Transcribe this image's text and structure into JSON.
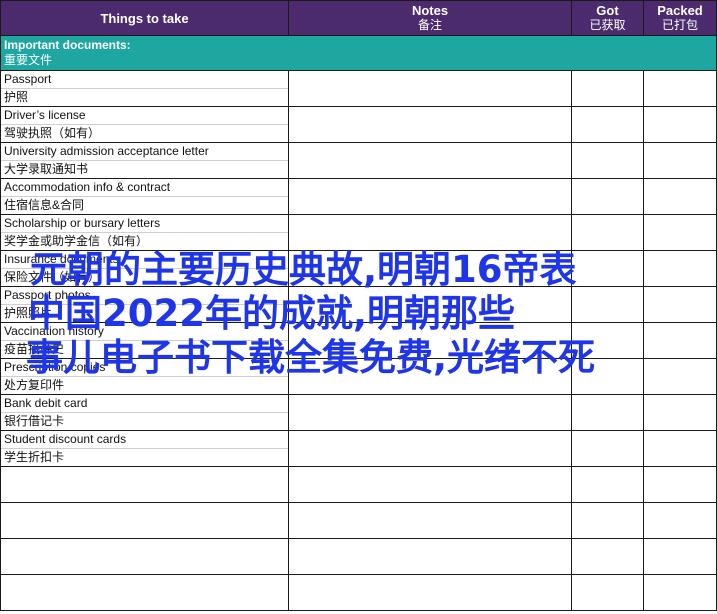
{
  "header": {
    "col1": "Things to take",
    "col2_en": "Notes",
    "col2_zh": "备注",
    "col3_en": "Got",
    "col3_zh": "已获取",
    "col4_en": "Packed",
    "col4_zh": "已打包"
  },
  "section": {
    "en": "Important documents:",
    "zh": "重要文件"
  },
  "items": [
    {
      "en": "Passport",
      "zh": "护照"
    },
    {
      "en": "Driver’s license",
      "zh": "驾驶执照（如有）"
    },
    {
      "en": "University admission acceptance letter",
      "zh": "大学录取通知书"
    },
    {
      "en": "Accommodation info & contract",
      "zh": "住宿信息&合同"
    },
    {
      "en": "Scholarship or bursary letters",
      "zh": "奖学金或助学金信（如有）"
    },
    {
      "en": "Insurance documents",
      "zh": "保险文件（如有）"
    },
    {
      "en": "Passport photos",
      "zh": "护照照片"
    },
    {
      "en": "Vaccination history",
      "zh": "疫苗接种史"
    },
    {
      "en": "Prescription copies",
      "zh": "处方复印件"
    },
    {
      "en": "Bank debit card",
      "zh": "银行借记卡"
    },
    {
      "en": "Student discount cards",
      "zh": "学生折扣卡"
    }
  ],
  "overlay": {
    "line1": "元朝的主要历史典故,明朝16帝表",
    "line2": "中国2022年的成就,明朝那些",
    "line3": "事儿电子书下载全集免费,光绪不死"
  },
  "colors": {
    "header_bg": "#4b2b6e",
    "section_bg": "#1ea6a0",
    "overlay_text": "#1f35e8"
  }
}
